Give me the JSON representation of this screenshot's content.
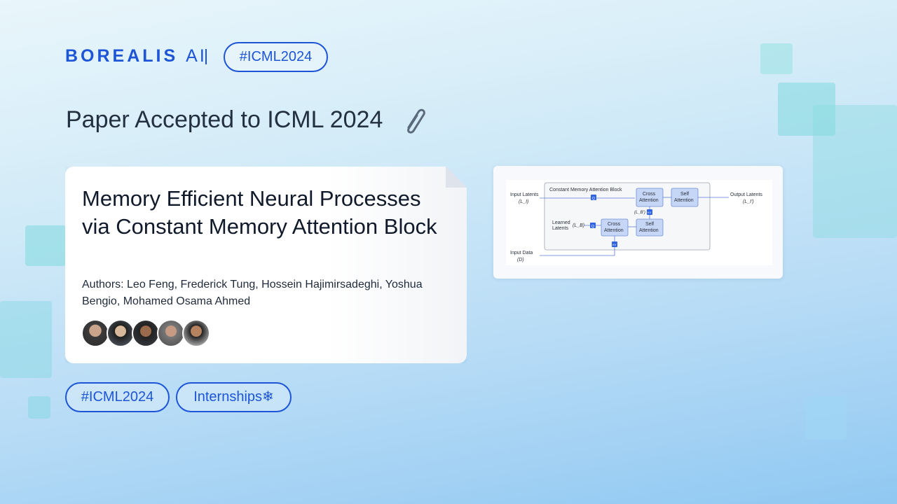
{
  "brand": {
    "name": "BOREALIS",
    "suffix": "AI",
    "color": "#1d55d6"
  },
  "header": {
    "hashtag": "#ICML2024"
  },
  "headline": {
    "text": "Paper Accepted to ICML 2024",
    "icon": "paperclip-icon"
  },
  "paper": {
    "title": "Memory Efficient Neural Processes via Constant Memory Attention Block",
    "authors": "Authors: Leo Feng, Frederick Tung, Hossein Hajimirsadeghi, Yoshua Bengio, Mohamed Osama Ahmed"
  },
  "figure": {
    "block_title": "Constant Memory Attention Block",
    "input_latents": "Input Latents",
    "input_latents_sym": "(L_I)",
    "learned_latents": "Learned",
    "learned_latents2": "Latents",
    "learned_sym": "(L_B)",
    "input_data": "Input Data",
    "input_data_sym": "(D)",
    "output_latents": "Output Latents",
    "output_sym": "(L_I')",
    "lb_prime": "(L_B')",
    "cross1": "Cross",
    "cross2": "Attention",
    "self1": "Self",
    "self2": "Attention",
    "q": "Q",
    "kv": "KV"
  },
  "tags": {
    "tag1": "#ICML2024",
    "tag2": "Internships",
    "tag2_icon": "❄"
  }
}
